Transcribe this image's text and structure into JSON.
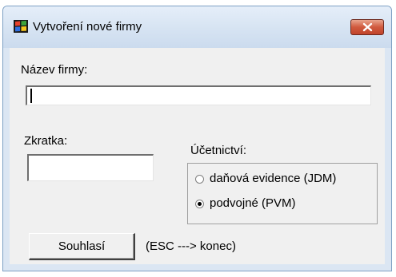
{
  "window": {
    "title": "Vytvoření nové firmy",
    "close_label": "×"
  },
  "form": {
    "company_name_label": "Název firmy:",
    "company_name_value": "",
    "abbreviation_label": "Zkratka:",
    "abbreviation_value": "",
    "accounting_label": "Účetnictví:",
    "accounting_options": [
      {
        "label": "daňová evidence (JDM)",
        "selected": false
      },
      {
        "label": "podvojné (PVM)",
        "selected": true
      }
    ],
    "submit_label": "Souhlasí",
    "escape_hint": "(ESC ---> konec)"
  },
  "colors": {
    "title_bar": "#dbe6f3",
    "close_button": "#c7472c",
    "dialog_background": "#f0f0f0"
  },
  "icons": {
    "app": "windows-flag-icon",
    "close": "close-icon"
  }
}
